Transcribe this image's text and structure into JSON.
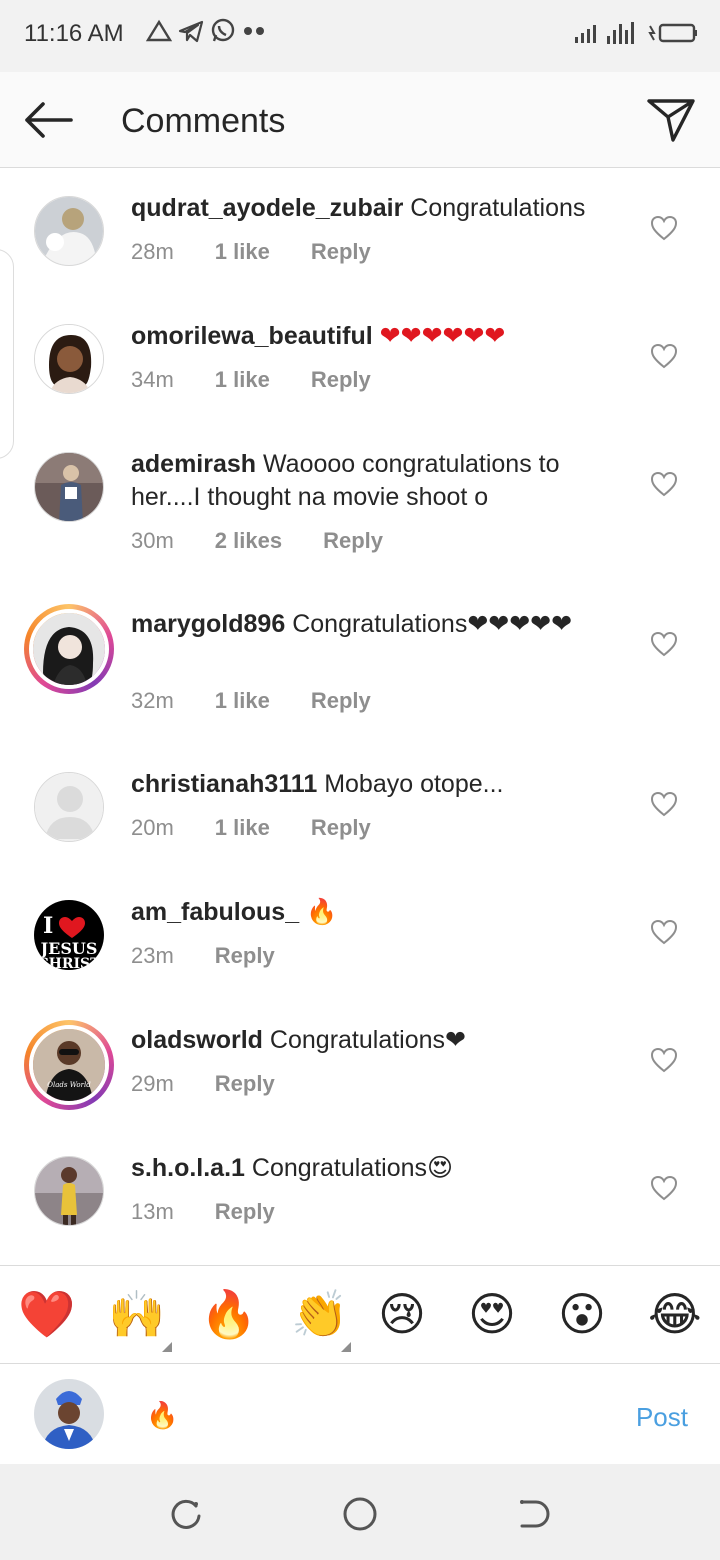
{
  "status_bar": {
    "time": "11:16 AM"
  },
  "header": {
    "title": "Comments"
  },
  "comments": [
    {
      "username": "qudrat_ayodele_zubair",
      "text": "Congratulations",
      "time": "28m",
      "likes": "1 like",
      "reply": "Reply"
    },
    {
      "username": "omorilewa_beautiful",
      "text": "❤❤❤❤❤❤",
      "time": "34m",
      "likes": "1 like",
      "reply": "Reply"
    },
    {
      "username": "ademirash",
      "text": "Waoooo congratulations to her....I thought na movie shoot o",
      "time": "30m",
      "likes": "2 likes",
      "reply": "Reply"
    },
    {
      "username": "marygold896",
      "text": "Congratulations❤❤❤❤❤",
      "time": "32m",
      "likes": "1 like",
      "reply": "Reply"
    },
    {
      "username": "christianah3111",
      "text": "Mobayo otope...",
      "time": "20m",
      "likes": "1 like",
      "reply": "Reply"
    },
    {
      "username": "am_fabulous_",
      "text": "🔥",
      "time": "23m",
      "reply": "Reply"
    },
    {
      "username": "oladsworld",
      "text": "Congratulations❤",
      "time": "29m",
      "reply": "Reply"
    },
    {
      "username": "s.h.o.l.a.1",
      "text": "Congratulations😍",
      "time": "13m",
      "reply": "Reply"
    }
  ],
  "avatar_texts": {
    "jesus_logo_line1": "I",
    "jesus_logo_line2": "JESUS",
    "jesus_logo_line3": "CHRIST",
    "olads_shirt": "Olads World"
  },
  "emoji_bar": [
    "❤️",
    "🙌",
    "🔥",
    "👏",
    "😢",
    "😍",
    "😮",
    "😂"
  ],
  "composer": {
    "input_value": "🔥",
    "post_label": "Post"
  },
  "colors": {
    "post_blue": "#4a9fe0",
    "meta_gray": "#8e8e8e",
    "heart_red": "#e0171f"
  }
}
